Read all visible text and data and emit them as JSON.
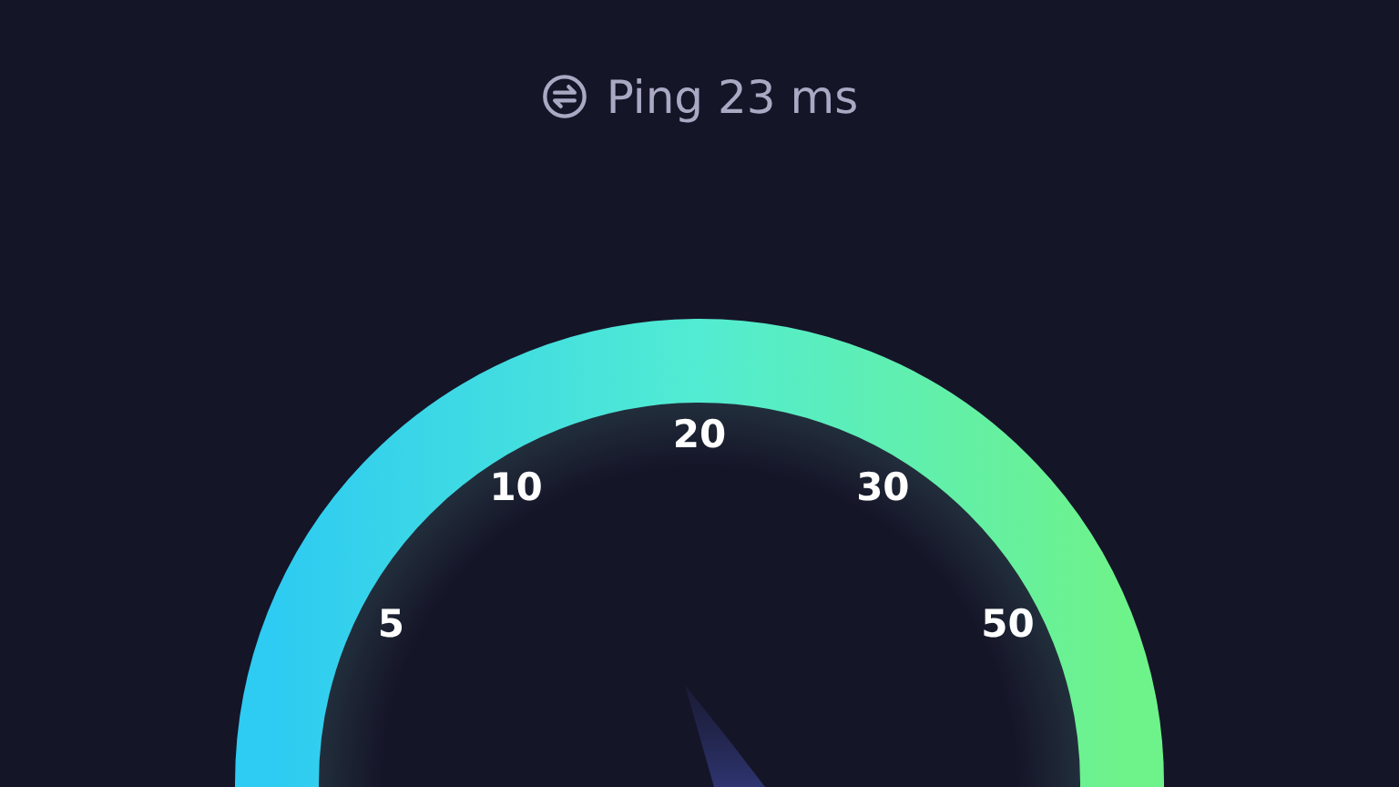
{
  "ping": {
    "text": "Ping 23 ms"
  },
  "gauge": {
    "scale_labels": [
      "5",
      "10",
      "20",
      "30",
      "50"
    ]
  }
}
